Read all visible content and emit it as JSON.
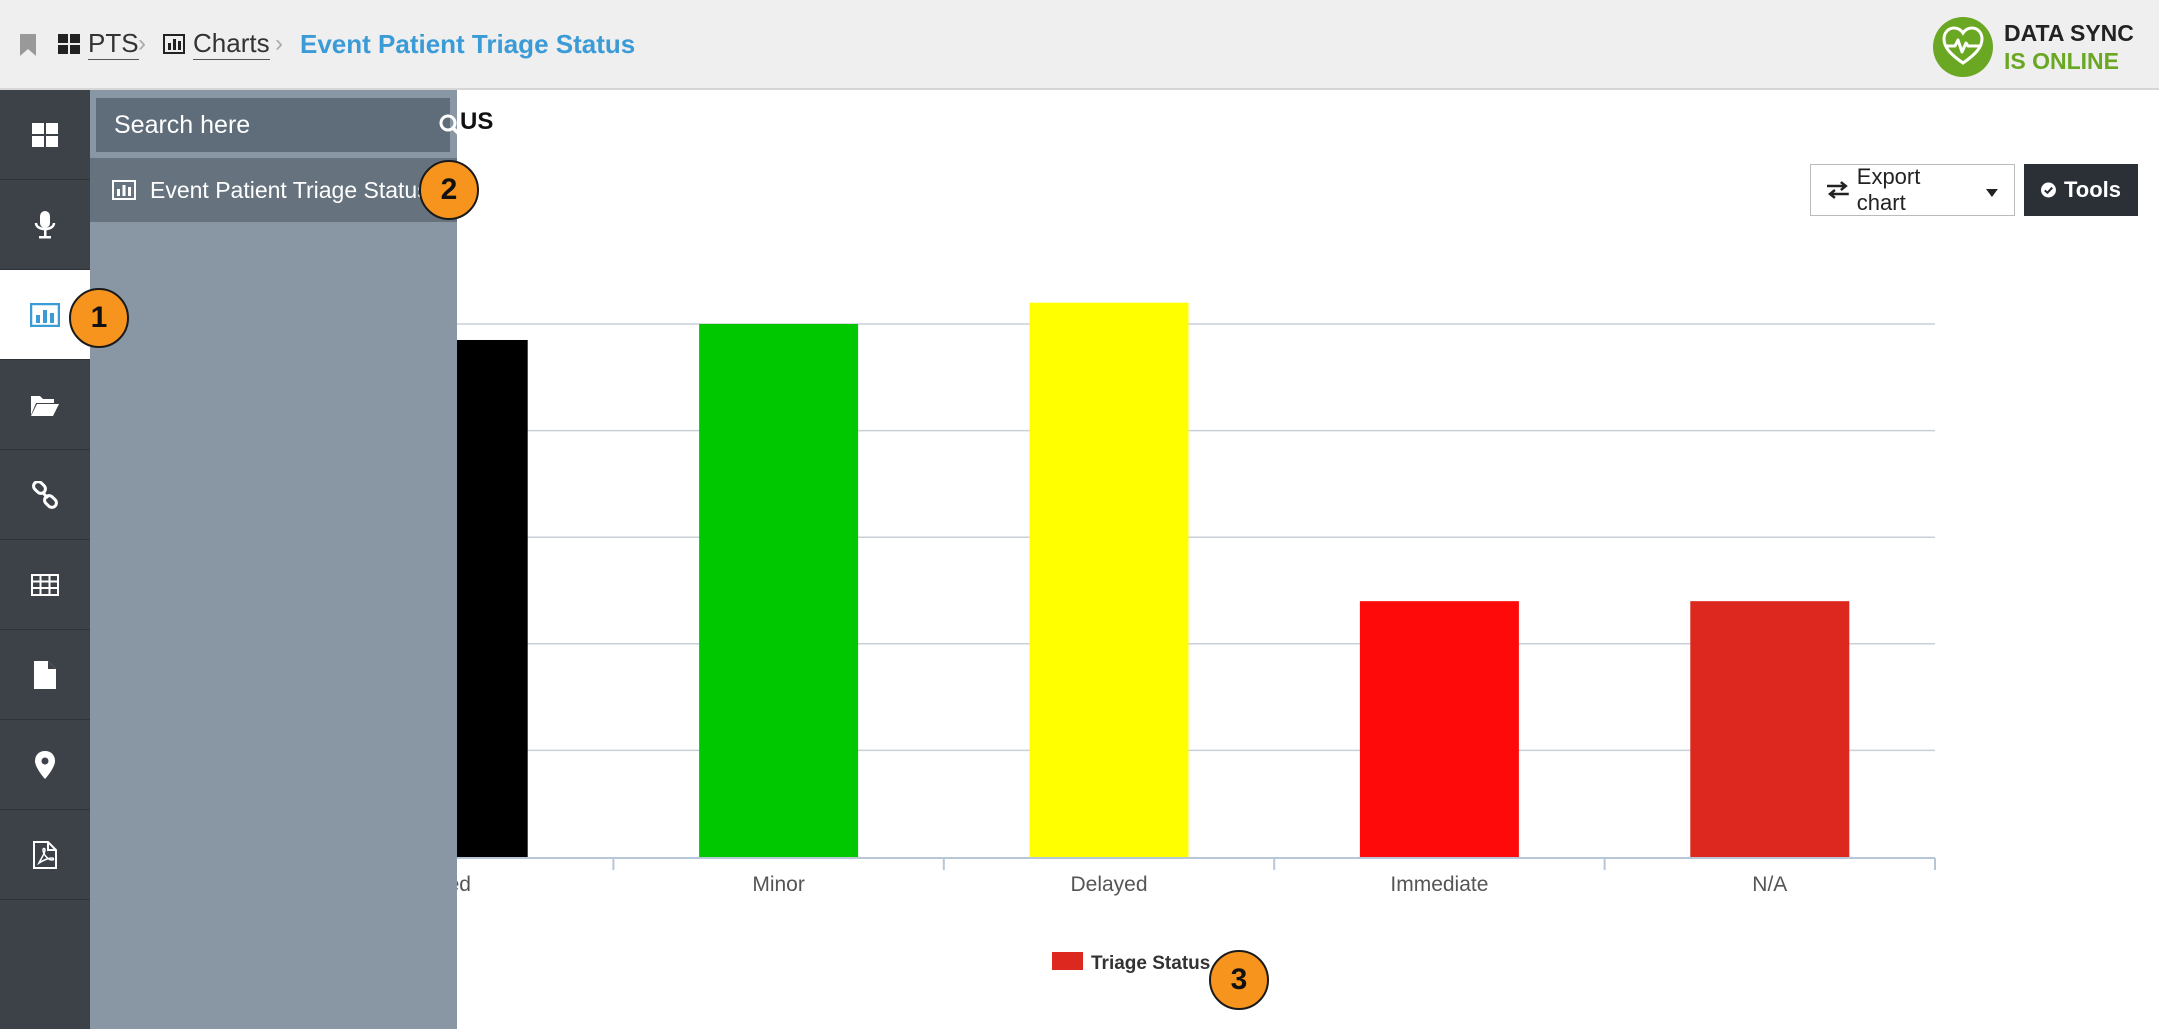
{
  "breadcrumb": {
    "home": "PTS",
    "section": "Charts",
    "current": "Event Patient Triage Status"
  },
  "sync_status": {
    "line1": "DATA SYNC",
    "line2": "IS ONLINE",
    "color": "#6aa723"
  },
  "sidebar": {
    "items": [
      {
        "icon": "dashboard-icon"
      },
      {
        "icon": "microphone-icon"
      },
      {
        "icon": "bar-chart-icon",
        "active": true
      },
      {
        "icon": "folder-open-icon"
      },
      {
        "icon": "link-icon"
      },
      {
        "icon": "table-icon"
      },
      {
        "icon": "file-icon"
      },
      {
        "icon": "map-marker-icon"
      },
      {
        "icon": "pdf-icon"
      }
    ]
  },
  "flyout": {
    "search_placeholder": "Search here",
    "items": [
      {
        "label": "Event Patient Triage Status",
        "icon": "bar-chart-icon"
      }
    ]
  },
  "main": {
    "title_fragment": "US",
    "export_label": "Export chart",
    "tools_label": "Tools"
  },
  "chart_data": {
    "type": "bar",
    "categories": [
      "Deceased",
      "Minor",
      "Delayed",
      "Immediate",
      "N/A"
    ],
    "visible_category_labels": [
      "ased",
      "Minor",
      "Delayed",
      "Immediate",
      "N/A"
    ],
    "values": [
      4.85,
      5.0,
      5.2,
      2.4,
      2.4
    ],
    "colors": [
      "#000000",
      "#00c800",
      "#ffff00",
      "#ff0a0a",
      "#dc281e"
    ],
    "ylim": [
      0,
      5
    ],
    "grid": true,
    "legend": {
      "label": "Triage Status",
      "color": "#dc281e",
      "placement": "bottom"
    }
  },
  "callouts": [
    "1",
    "2",
    "3"
  ]
}
